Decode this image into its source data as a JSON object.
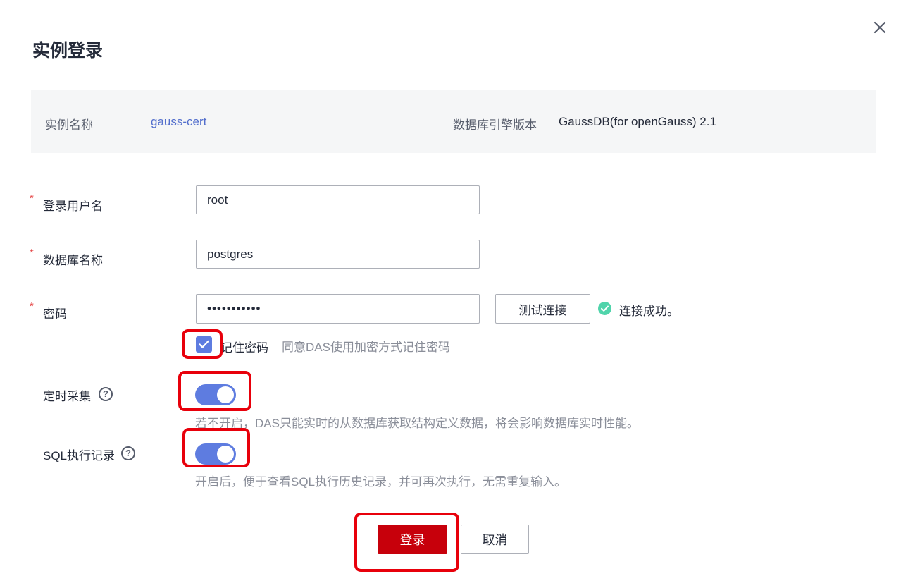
{
  "dialog": {
    "title": "实例登录"
  },
  "info": {
    "instance_name_label": "实例名称",
    "instance_name_value": "gauss-cert",
    "engine_version_label": "数据库引擎版本",
    "engine_version_value": "GaussDB(for openGauss) 2.1"
  },
  "form": {
    "required_mark": "*",
    "username": {
      "label": "登录用户名",
      "value": "root"
    },
    "database": {
      "label": "数据库名称",
      "value": "postgres"
    },
    "password": {
      "label": "密码",
      "value": "•••••••••••"
    },
    "test_button": "测试连接",
    "test_result": "连接成功。",
    "remember": {
      "label": "记住密码",
      "hint": "同意DAS使用加密方式记住密码",
      "checked": true
    },
    "scheduled_collect": {
      "label": "定时采集",
      "enabled": true,
      "hint": "若不开启，DAS只能实时的从数据库获取结构定义数据，将会影响数据库实时性能。"
    },
    "sql_history": {
      "label": "SQL执行记录",
      "enabled": true,
      "hint": "开启后，便于查看SQL执行历史记录，并可再次执行，无需重复输入。"
    },
    "help_glyph": "?"
  },
  "footer": {
    "login_button": "登录",
    "cancel_button": "取消"
  },
  "colors": {
    "primary": "#c7000b",
    "accent": "#5e7ce0",
    "link": "#526ecc",
    "success": "#50d4ab",
    "highlight": "#e8000b"
  },
  "icons": [
    "close-icon",
    "check-icon",
    "success-check-icon",
    "help-icon"
  ]
}
